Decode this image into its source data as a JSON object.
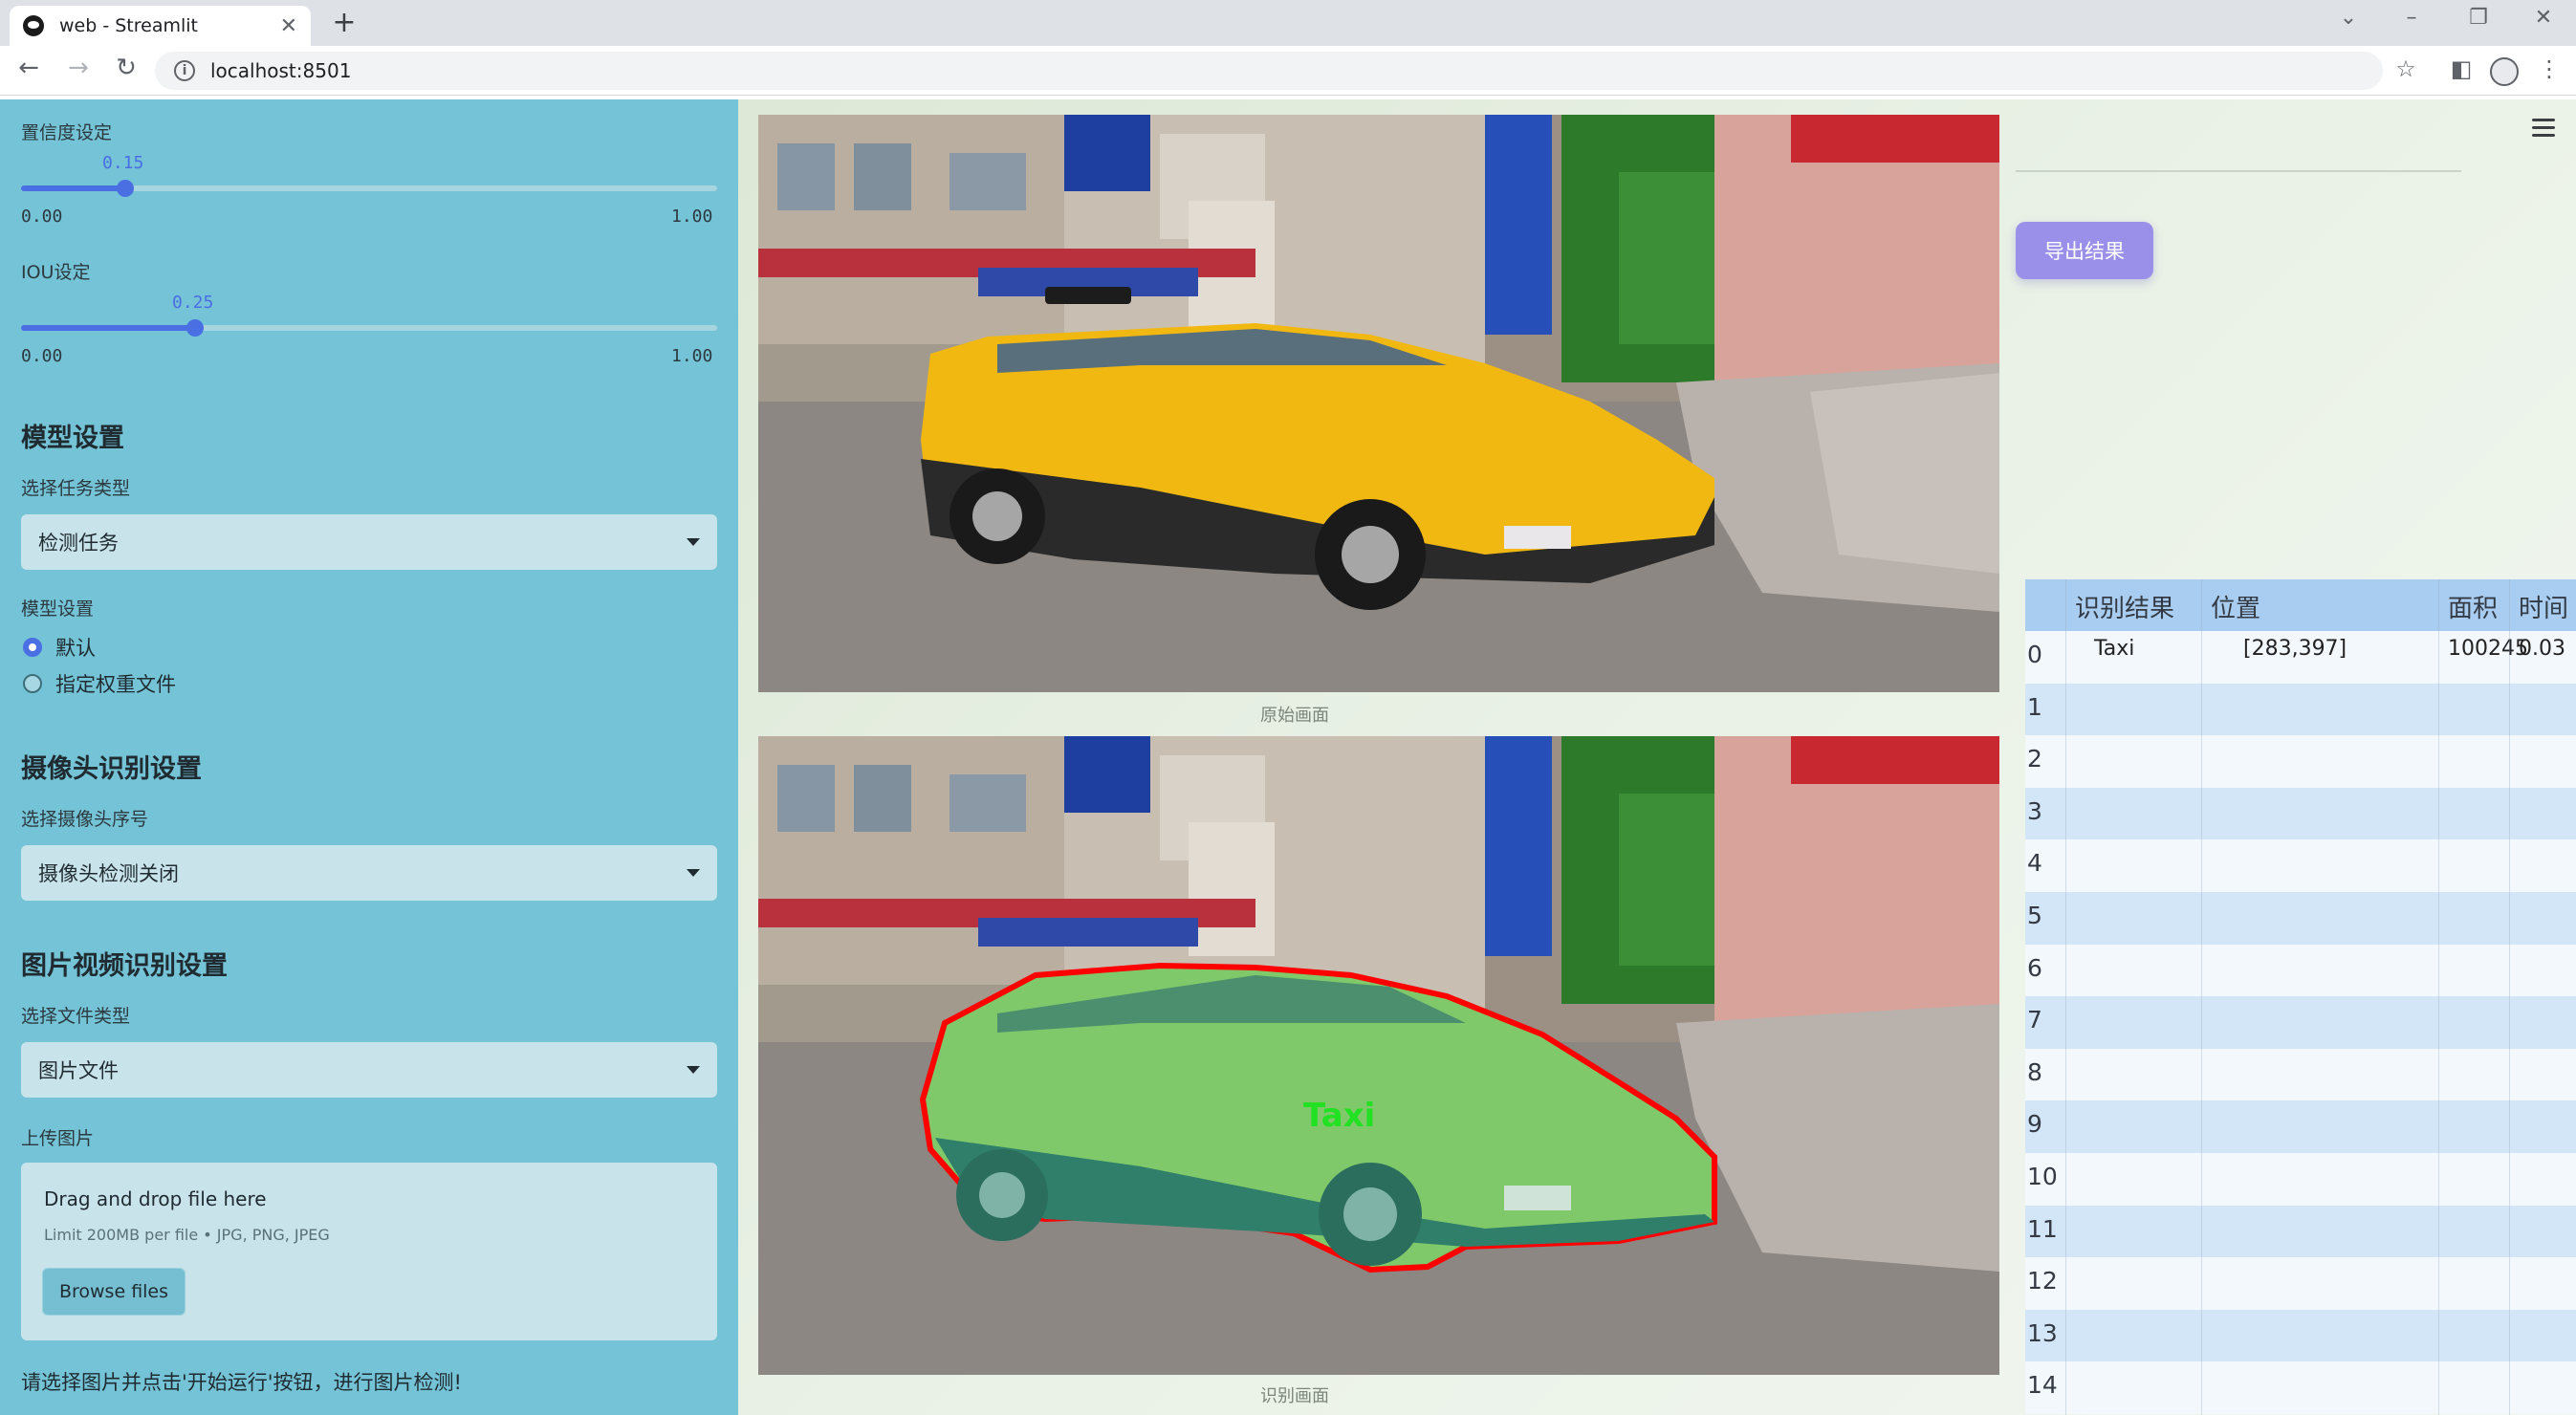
{
  "browser": {
    "tab_title": "web - Streamlit",
    "url": "localhost:8501"
  },
  "sidebar": {
    "confidence": {
      "label": "置信度设定",
      "value_text": "0.15",
      "value": 0.15,
      "min": "0.00",
      "max": "1.00"
    },
    "iou": {
      "label": "IOU设定",
      "value_text": "0.25",
      "value": 0.25,
      "min": "0.00",
      "max": "1.00"
    },
    "model_section": {
      "heading": "模型设置",
      "task_label": "选择任务类型",
      "task_value": "检测任务",
      "model_label": "模型设置",
      "radio_default": "默认",
      "radio_custom": "指定权重文件",
      "selected": "默认"
    },
    "camera_section": {
      "heading": "摄像头识别设置",
      "camera_label": "选择摄像头序号",
      "camera_value": "摄像头检测关闭"
    },
    "file_section": {
      "heading": "图片视频识别设置",
      "type_label": "选择文件类型",
      "type_value": "图片文件",
      "upload_label": "上传图片",
      "drag_text": "Drag and drop file here",
      "limit_text": "Limit 200MB per file • JPG, PNG, JPEG",
      "browse_label": "Browse files"
    },
    "note": "请选择图片并点击'开始运行'按钮，进行图片检测!"
  },
  "main": {
    "original_caption": "原始画面",
    "result_caption": "识别画面",
    "detection_label": "Taxi",
    "export_label": "导出结果"
  },
  "table": {
    "columns": [
      "识别结果",
      "位置",
      "面积",
      "时间"
    ],
    "rows": [
      {
        "index": "0",
        "result": "Taxi",
        "position": "[283,397]",
        "area": "100245",
        "time": "0.03"
      },
      {
        "index": "1"
      },
      {
        "index": "2"
      },
      {
        "index": "3"
      },
      {
        "index": "4"
      },
      {
        "index": "5"
      },
      {
        "index": "6"
      },
      {
        "index": "7"
      },
      {
        "index": "8"
      },
      {
        "index": "9"
      },
      {
        "index": "10"
      },
      {
        "index": "11"
      },
      {
        "index": "12"
      },
      {
        "index": "13"
      },
      {
        "index": "14"
      }
    ]
  },
  "colors": {
    "sidebar_bg": "#74c3d6",
    "accent": "#4a6fe3",
    "export_button": "#9a90ea",
    "taxi_yellow": "#f1b812",
    "mask_green": "#7fc96a",
    "mask_outline": "#ff0000",
    "label_green": "#22e022"
  }
}
